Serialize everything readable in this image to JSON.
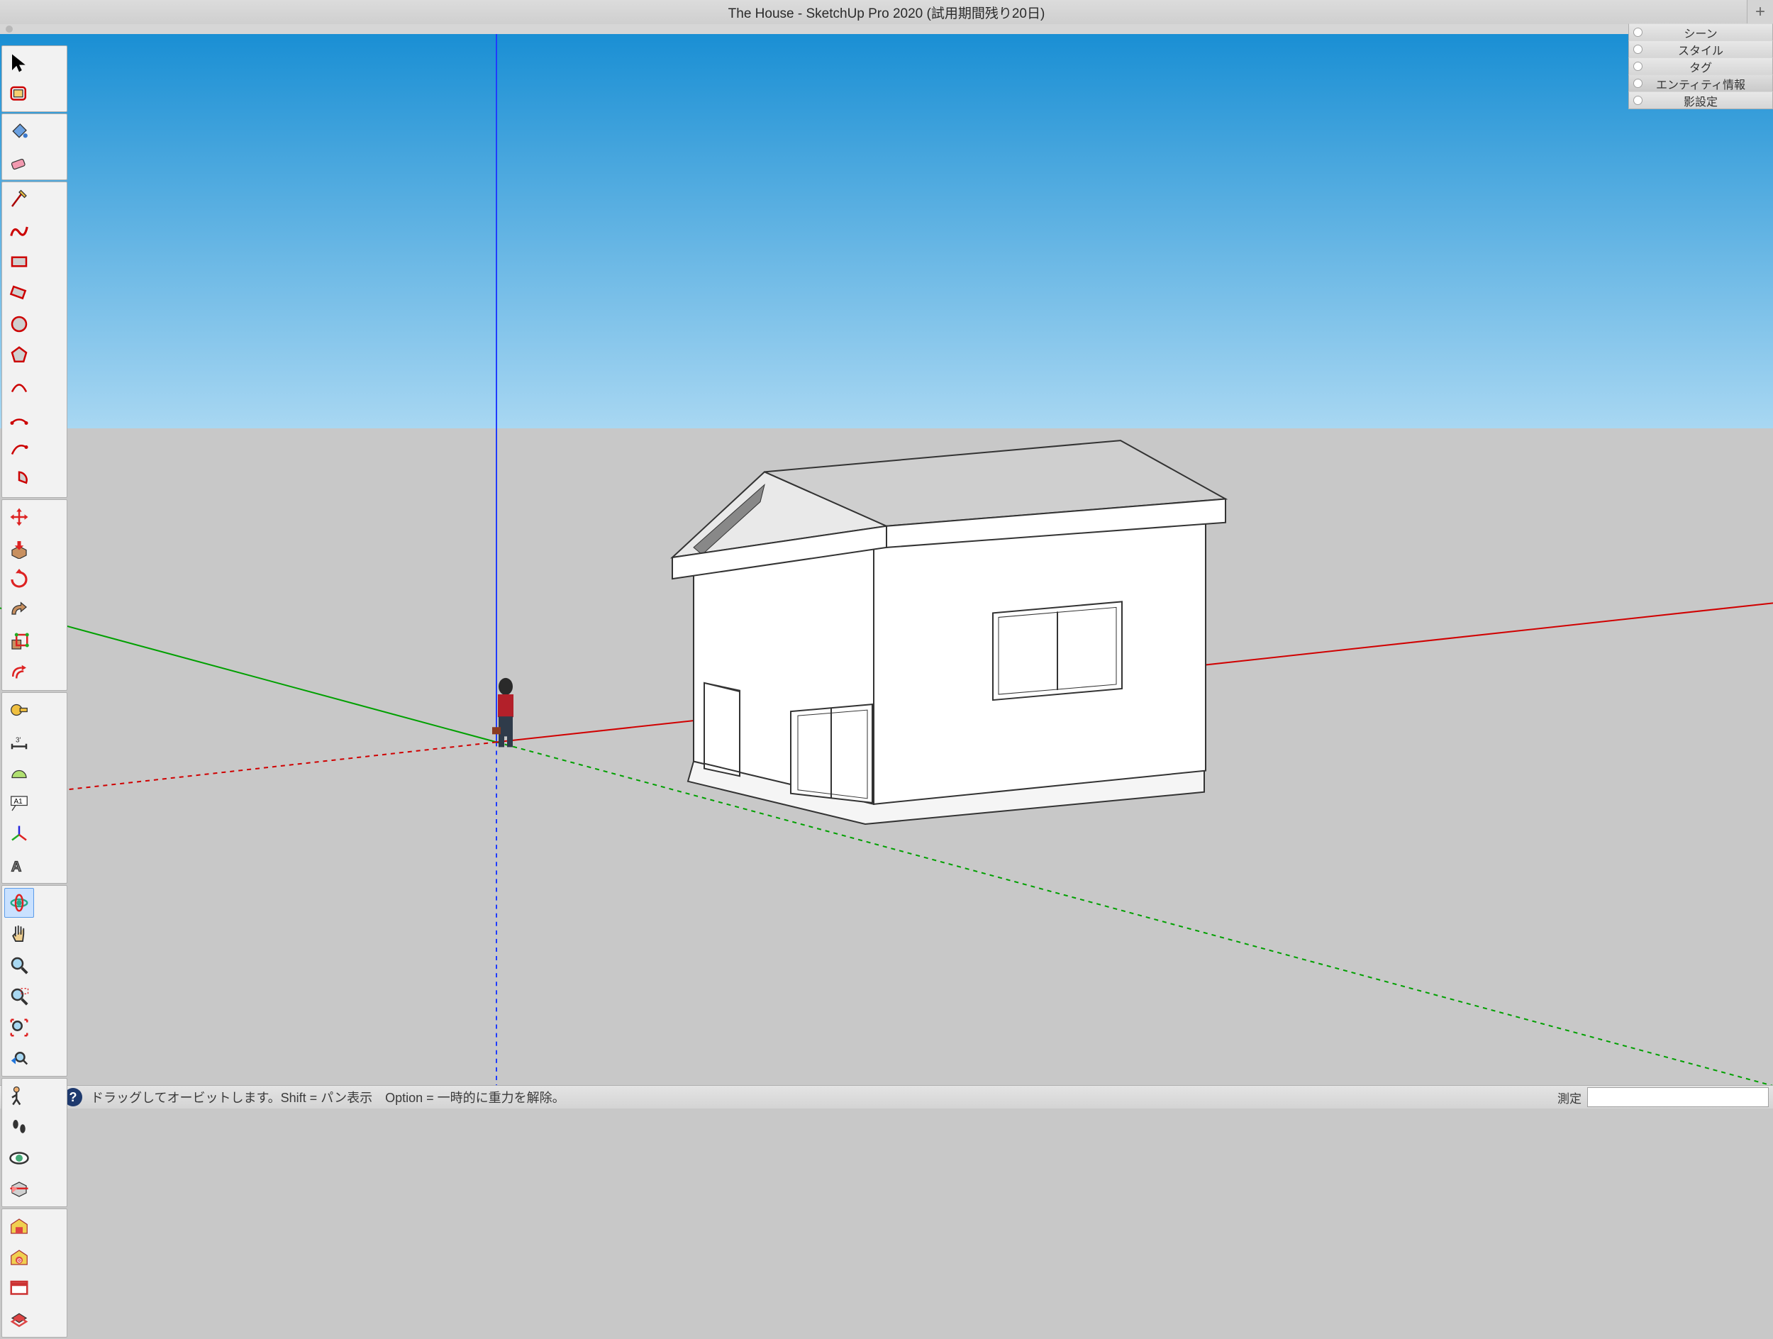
{
  "title": "The House - SketchUp Pro 2020 (試用期間残り20日)",
  "toolbar": {
    "groups": [
      [
        "select",
        "lasso"
      ],
      [
        "eraser",
        "paint"
      ],
      [
        "line",
        "freehand",
        "rectangle",
        "rotrect",
        "circle",
        "polygon",
        "arc",
        "arc2",
        "arc3",
        "pie"
      ],
      [
        "move",
        "pushpull",
        "rotate",
        "followme",
        "scale",
        "offset"
      ],
      [
        "tape",
        "dimension",
        "protractor",
        "text",
        "axes",
        "3dtext"
      ],
      [
        "orbit",
        "pan",
        "zoom",
        "zoomwin",
        "zoomext",
        "prev"
      ],
      [
        "position",
        "walk",
        "lookaround",
        "section"
      ],
      [
        "warehouse",
        "extwarehouse",
        "layout",
        "advanced"
      ]
    ],
    "active": "orbit"
  },
  "tray": {
    "items": [
      {
        "label": "シーン",
        "selected": false
      },
      {
        "label": "スタイル",
        "selected": false
      },
      {
        "label": "タグ",
        "selected": false
      },
      {
        "label": "エンティティ情報",
        "selected": true
      },
      {
        "label": "影設定",
        "selected": false
      }
    ]
  },
  "statusbar": {
    "hint": "ドラッグしてオービットします。Shift = パン表示　Option = 一時的に重力を解除。",
    "measure_label": "測定",
    "measure_value": ""
  }
}
